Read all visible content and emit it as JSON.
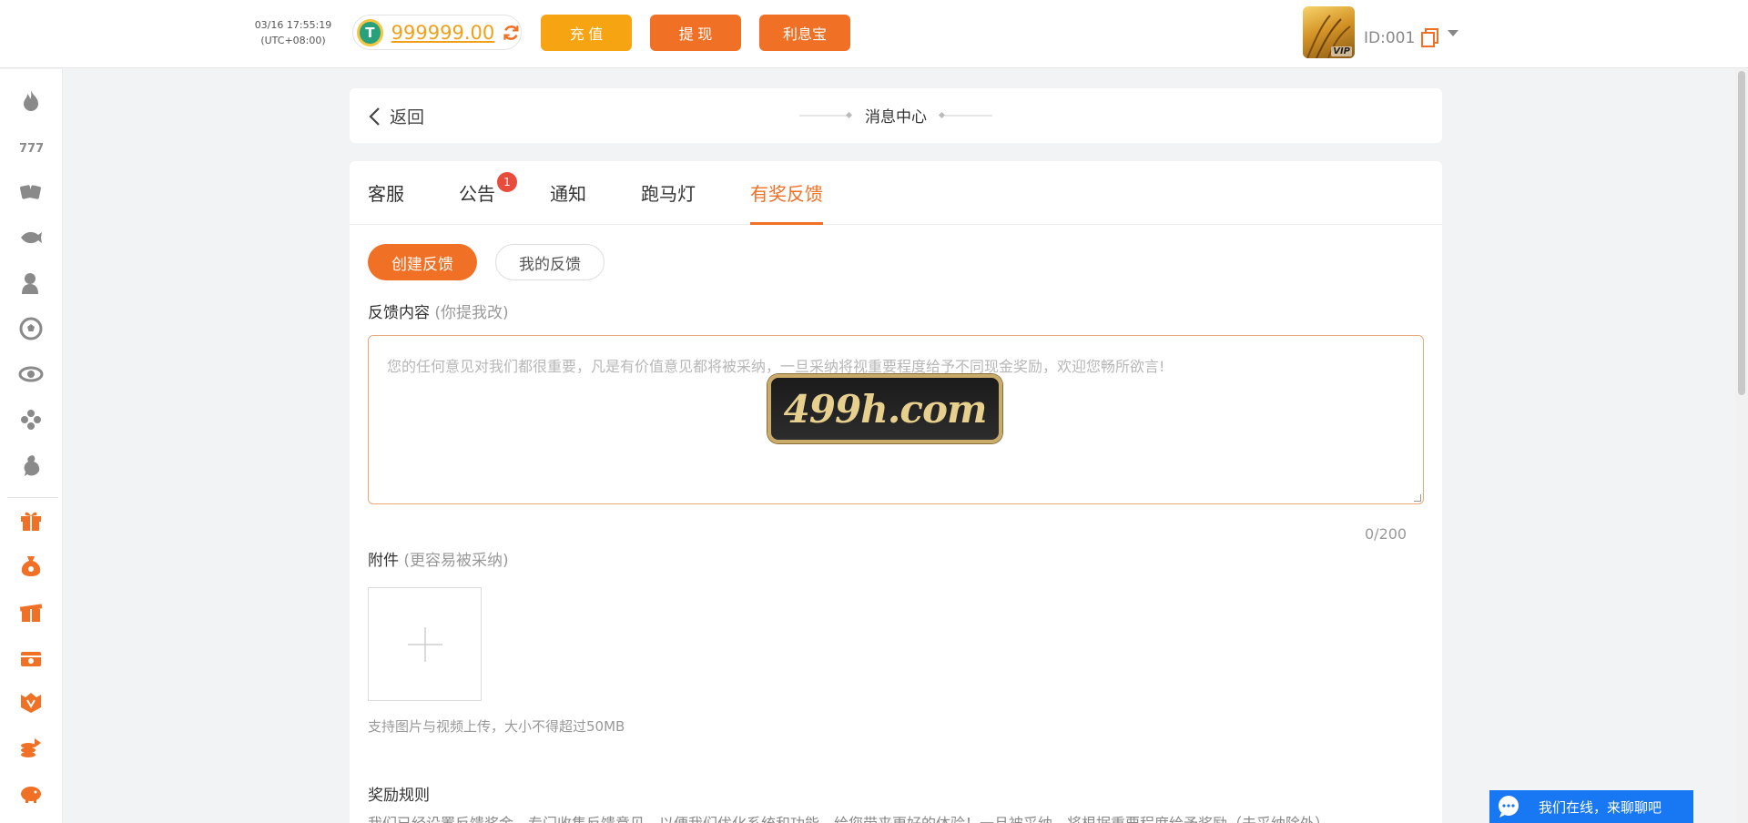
{
  "topbar": {
    "datetime": "03/16 17:55:19",
    "timezone": "(UTC+08:00)",
    "balance": "999999.00",
    "deposit_label": "充 值",
    "withdraw_label": "提 现",
    "interest_label": "利息宝",
    "vip_label": "VIP",
    "user_id": "ID:001"
  },
  "sidebar": {
    "icons": [
      "flame-icon",
      "slots-icon",
      "cards-icon",
      "fish-icon",
      "live-dealer-icon",
      "soccer-icon",
      "esports-icon",
      "lottery-icon",
      "cockfight-icon",
      "gift-icon",
      "money-bag-icon",
      "gift-box-icon",
      "treasure-chest-icon",
      "vip-badge-icon",
      "coin-stack-icon",
      "piggy-bank-icon"
    ],
    "colors": {
      "gray": "#8a8a8a",
      "orange": "#f07025"
    }
  },
  "header": {
    "back_label": "返回",
    "title": "消息中心"
  },
  "tabs": [
    {
      "label": "客服"
    },
    {
      "label": "公告",
      "badge": "1"
    },
    {
      "label": "通知"
    },
    {
      "label": "跑马灯"
    },
    {
      "label": "有奖反馈",
      "active": true
    }
  ],
  "subtabs": {
    "create": "创建反馈",
    "mine": "我的反馈"
  },
  "form": {
    "content_label": "反馈内容",
    "content_hint": "(你提我改)",
    "placeholder": "您的任何意见对我们都很重要，凡是有价值意见都将被采纳，一旦采纳将视重要程度给予不同现金奖励，欢迎您畅所欲言!",
    "counter": "0/200",
    "attachment_label": "附件",
    "attachment_hint": "(更容易被采纳)",
    "upload_note": "支持图片与视频上传，大小不得超过50MB",
    "rules_title": "奖励规则",
    "rules_text": "我们已经设置反馈奖金，专门收集反馈意见，以便我们优化系统和功能，给您带来更好的体验！一旦被采纳，将根据重要程度给予奖励（未采纳除外）"
  },
  "watermark": "499h.com",
  "chat": {
    "label": "我们在线，来聊聊吧"
  },
  "colors": {
    "accent": "#f07025",
    "deposit": "#f7a413",
    "chat": "#1877f2"
  }
}
